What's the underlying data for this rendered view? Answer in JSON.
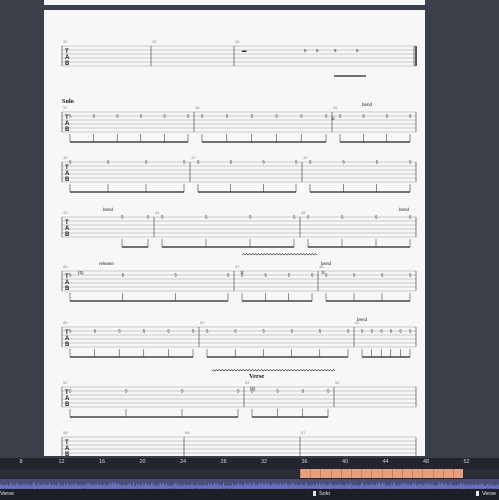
{
  "score": {
    "rows": [
      {
        "bars": [
          "34",
          "35",
          "36"
        ],
        "section": ""
      },
      {
        "bars": [
          "37",
          "38",
          "39"
        ],
        "section": "Solo"
      },
      {
        "bars": [
          "40",
          "41",
          "42"
        ],
        "section": ""
      },
      {
        "bars": [
          "43",
          "44",
          "45"
        ],
        "section": ""
      },
      {
        "bars": [
          "46",
          "47",
          "48"
        ],
        "section": ""
      },
      {
        "bars": [
          "49",
          "50",
          "51"
        ],
        "section": ""
      },
      {
        "bars": [
          "52",
          "53",
          "54"
        ],
        "section": "Verse"
      },
      {
        "bars": [
          "55",
          "56",
          "57"
        ],
        "section": ""
      }
    ],
    "tab_top": "T",
    "tab_mid": "A",
    "tab_bot": "B",
    "fret_5": "5",
    "fret_paren_5": "(5)",
    "fret_circle_5": "⑤",
    "annotations": {
      "bend": "bend",
      "release": "release"
    }
  },
  "timeline": {
    "ticks": [
      "8",
      "12",
      "16",
      "20",
      "24",
      "28",
      "32",
      "36",
      "40",
      "44",
      "48",
      "52"
    ],
    "markers": [
      {
        "label": "Verse",
        "side": "left"
      },
      {
        "label": "Solo"
      },
      {
        "label": "Verse",
        "side": "right"
      }
    ],
    "colors": {
      "selection": "#e8a07a",
      "waveform": "#6f74c9",
      "track_bg": "#22252d"
    }
  }
}
